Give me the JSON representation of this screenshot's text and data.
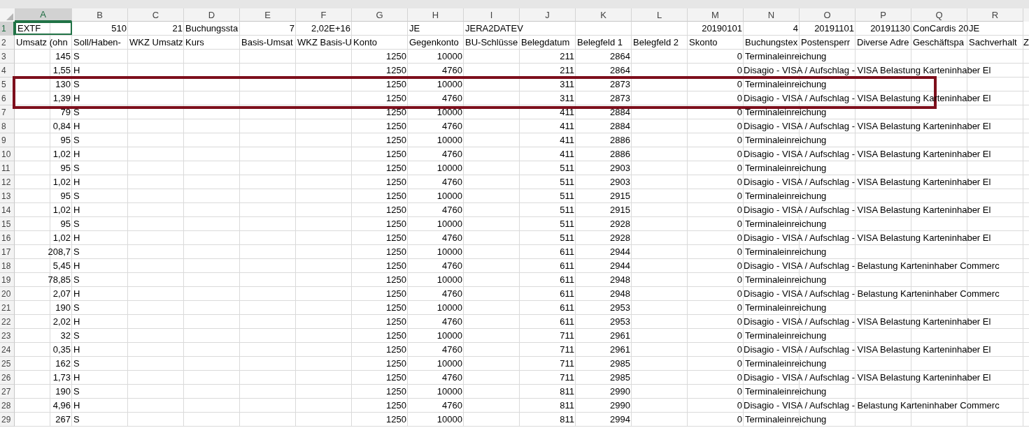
{
  "columns": [
    {
      "label": "A",
      "selected": true
    },
    {
      "label": "B",
      "selected": false
    },
    {
      "label": "C",
      "selected": false
    },
    {
      "label": "D",
      "selected": false
    },
    {
      "label": "E",
      "selected": false
    },
    {
      "label": "F",
      "selected": false
    },
    {
      "label": "G",
      "selected": false
    },
    {
      "label": "H",
      "selected": false
    },
    {
      "label": "I",
      "selected": false
    },
    {
      "label": "J",
      "selected": false
    },
    {
      "label": "K",
      "selected": false
    },
    {
      "label": "L",
      "selected": false
    },
    {
      "label": "M",
      "selected": false
    },
    {
      "label": "N",
      "selected": false
    },
    {
      "label": "O",
      "selected": false
    },
    {
      "label": "P",
      "selected": false
    },
    {
      "label": "Q",
      "selected": false
    },
    {
      "label": "R",
      "selected": false
    }
  ],
  "rows": [
    {
      "number": "1",
      "selected": true,
      "outlined": false,
      "cells": [
        {
          "text": "EXTF",
          "kind": "text"
        },
        {
          "text": "510",
          "kind": "number"
        },
        {
          "text": "21",
          "kind": "number"
        },
        {
          "text": "Buchungssta",
          "kind": "text"
        },
        {
          "text": "7",
          "kind": "number"
        },
        {
          "text": "2,02E+16",
          "kind": "number"
        },
        null,
        {
          "text": "JE",
          "kind": "text"
        },
        {
          "text": "JERA2DATEV",
          "kind": "text"
        },
        null,
        null,
        null,
        {
          "text": "20190101",
          "kind": "number"
        },
        {
          "text": "4",
          "kind": "number"
        },
        {
          "text": "20191101",
          "kind": "number"
        },
        {
          "text": "20191130",
          "kind": "number"
        },
        {
          "text": "ConCardis 20",
          "kind": "text"
        },
        {
          "text": "JE",
          "kind": "text"
        }
      ]
    },
    {
      "number": "2",
      "selected": false,
      "outlined": false,
      "cells": [
        {
          "text": "Umsatz (ohn",
          "kind": "text"
        },
        {
          "text": "Soll/Haben-",
          "kind": "text"
        },
        {
          "text": "WKZ Umsatz",
          "kind": "text"
        },
        {
          "text": "Kurs",
          "kind": "text"
        },
        {
          "text": "Basis-Umsat",
          "kind": "text"
        },
        {
          "text": "WKZ Basis-U",
          "kind": "text"
        },
        {
          "text": "Konto",
          "kind": "text"
        },
        {
          "text": "Gegenkonto",
          "kind": "text"
        },
        {
          "text": "BU-Schlüsse",
          "kind": "text"
        },
        {
          "text": "Belegdatum",
          "kind": "text"
        },
        {
          "text": "Belegfeld 1",
          "kind": "text"
        },
        {
          "text": "Belegfeld 2",
          "kind": "text"
        },
        {
          "text": "Skonto",
          "kind": "text"
        },
        {
          "text": "Buchungstex",
          "kind": "text"
        },
        {
          "text": "Postensperr",
          "kind": "text"
        },
        {
          "text": "Diverse Adre",
          "kind": "text"
        },
        {
          "text": "Geschäftspa",
          "kind": "text"
        },
        {
          "text": "Sachverhalt",
          "kind": "text"
        },
        {
          "text": "Z",
          "kind": "text"
        }
      ]
    },
    {
      "number": "3",
      "selected": false,
      "outlined": false,
      "cells": [
        {
          "text": "145",
          "kind": "number"
        },
        {
          "text": "S",
          "kind": "text"
        },
        null,
        null,
        null,
        null,
        {
          "text": "1250",
          "kind": "number"
        },
        {
          "text": "10000",
          "kind": "number"
        },
        null,
        {
          "text": "211",
          "kind": "number"
        },
        {
          "text": "2864",
          "kind": "number"
        },
        null,
        {
          "text": "0",
          "kind": "number"
        },
        {
          "text": "Terminaleinreichung",
          "kind": "text"
        }
      ]
    },
    {
      "number": "4",
      "selected": false,
      "outlined": false,
      "cells": [
        {
          "text": "1,55",
          "kind": "number"
        },
        {
          "text": "H",
          "kind": "text"
        },
        null,
        null,
        null,
        null,
        {
          "text": "1250",
          "kind": "number"
        },
        {
          "text": "4760",
          "kind": "number"
        },
        null,
        {
          "text": "211",
          "kind": "number"
        },
        {
          "text": "2864",
          "kind": "number"
        },
        null,
        {
          "text": "0",
          "kind": "number"
        },
        {
          "text": "Disagio - VISA / Aufschlag - VISA Belastung Karteninhaber El",
          "kind": "text"
        }
      ]
    },
    {
      "number": "5",
      "selected": false,
      "outlined": true,
      "cells": [
        {
          "text": "130",
          "kind": "number"
        },
        {
          "text": "S",
          "kind": "text"
        },
        null,
        null,
        null,
        null,
        {
          "text": "1250",
          "kind": "number"
        },
        {
          "text": "10000",
          "kind": "number"
        },
        null,
        {
          "text": "311",
          "kind": "number"
        },
        {
          "text": "2873",
          "kind": "number"
        },
        null,
        {
          "text": "0",
          "kind": "number"
        },
        {
          "text": "Terminaleinreichung",
          "kind": "text"
        }
      ]
    },
    {
      "number": "6",
      "selected": false,
      "outlined": true,
      "cells": [
        {
          "text": "1,39",
          "kind": "number"
        },
        {
          "text": "H",
          "kind": "text"
        },
        null,
        null,
        null,
        null,
        {
          "text": "1250",
          "kind": "number"
        },
        {
          "text": "4760",
          "kind": "number"
        },
        null,
        {
          "text": "311",
          "kind": "number"
        },
        {
          "text": "2873",
          "kind": "number"
        },
        null,
        {
          "text": "0",
          "kind": "number"
        },
        {
          "text": "Disagio - VISA / Aufschlag - VISA Belastung Karteninhaber El",
          "kind": "text"
        }
      ]
    },
    {
      "number": "7",
      "selected": false,
      "outlined": false,
      "cells": [
        {
          "text": "79",
          "kind": "number"
        },
        {
          "text": "S",
          "kind": "text"
        },
        null,
        null,
        null,
        null,
        {
          "text": "1250",
          "kind": "number"
        },
        {
          "text": "10000",
          "kind": "number"
        },
        null,
        {
          "text": "411",
          "kind": "number"
        },
        {
          "text": "2884",
          "kind": "number"
        },
        null,
        {
          "text": "0",
          "kind": "number"
        },
        {
          "text": "Terminaleinreichung",
          "kind": "text"
        }
      ]
    },
    {
      "number": "8",
      "selected": false,
      "outlined": false,
      "cells": [
        {
          "text": "0,84",
          "kind": "number"
        },
        {
          "text": "H",
          "kind": "text"
        },
        null,
        null,
        null,
        null,
        {
          "text": "1250",
          "kind": "number"
        },
        {
          "text": "4760",
          "kind": "number"
        },
        null,
        {
          "text": "411",
          "kind": "number"
        },
        {
          "text": "2884",
          "kind": "number"
        },
        null,
        {
          "text": "0",
          "kind": "number"
        },
        {
          "text": "Disagio - VISA / Aufschlag - VISA Belastung Karteninhaber El",
          "kind": "text"
        }
      ]
    },
    {
      "number": "9",
      "selected": false,
      "outlined": false,
      "cells": [
        {
          "text": "95",
          "kind": "number"
        },
        {
          "text": "S",
          "kind": "text"
        },
        null,
        null,
        null,
        null,
        {
          "text": "1250",
          "kind": "number"
        },
        {
          "text": "10000",
          "kind": "number"
        },
        null,
        {
          "text": "411",
          "kind": "number"
        },
        {
          "text": "2886",
          "kind": "number"
        },
        null,
        {
          "text": "0",
          "kind": "number"
        },
        {
          "text": "Terminaleinreichung",
          "kind": "text"
        }
      ]
    },
    {
      "number": "10",
      "selected": false,
      "outlined": false,
      "cells": [
        {
          "text": "1,02",
          "kind": "number"
        },
        {
          "text": "H",
          "kind": "text"
        },
        null,
        null,
        null,
        null,
        {
          "text": "1250",
          "kind": "number"
        },
        {
          "text": "4760",
          "kind": "number"
        },
        null,
        {
          "text": "411",
          "kind": "number"
        },
        {
          "text": "2886",
          "kind": "number"
        },
        null,
        {
          "text": "0",
          "kind": "number"
        },
        {
          "text": "Disagio - VISA / Aufschlag - VISA Belastung Karteninhaber El",
          "kind": "text"
        }
      ]
    },
    {
      "number": "11",
      "selected": false,
      "outlined": false,
      "cells": [
        {
          "text": "95",
          "kind": "number"
        },
        {
          "text": "S",
          "kind": "text"
        },
        null,
        null,
        null,
        null,
        {
          "text": "1250",
          "kind": "number"
        },
        {
          "text": "10000",
          "kind": "number"
        },
        null,
        {
          "text": "511",
          "kind": "number"
        },
        {
          "text": "2903",
          "kind": "number"
        },
        null,
        {
          "text": "0",
          "kind": "number"
        },
        {
          "text": "Terminaleinreichung",
          "kind": "text"
        }
      ]
    },
    {
      "number": "12",
      "selected": false,
      "outlined": false,
      "cells": [
        {
          "text": "1,02",
          "kind": "number"
        },
        {
          "text": "H",
          "kind": "text"
        },
        null,
        null,
        null,
        null,
        {
          "text": "1250",
          "kind": "number"
        },
        {
          "text": "4760",
          "kind": "number"
        },
        null,
        {
          "text": "511",
          "kind": "number"
        },
        {
          "text": "2903",
          "kind": "number"
        },
        null,
        {
          "text": "0",
          "kind": "number"
        },
        {
          "text": "Disagio - VISA / Aufschlag - VISA Belastung Karteninhaber El",
          "kind": "text"
        }
      ]
    },
    {
      "number": "13",
      "selected": false,
      "outlined": false,
      "cells": [
        {
          "text": "95",
          "kind": "number"
        },
        {
          "text": "S",
          "kind": "text"
        },
        null,
        null,
        null,
        null,
        {
          "text": "1250",
          "kind": "number"
        },
        {
          "text": "10000",
          "kind": "number"
        },
        null,
        {
          "text": "511",
          "kind": "number"
        },
        {
          "text": "2915",
          "kind": "number"
        },
        null,
        {
          "text": "0",
          "kind": "number"
        },
        {
          "text": "Terminaleinreichung",
          "kind": "text"
        }
      ]
    },
    {
      "number": "14",
      "selected": false,
      "outlined": false,
      "cells": [
        {
          "text": "1,02",
          "kind": "number"
        },
        {
          "text": "H",
          "kind": "text"
        },
        null,
        null,
        null,
        null,
        {
          "text": "1250",
          "kind": "number"
        },
        {
          "text": "4760",
          "kind": "number"
        },
        null,
        {
          "text": "511",
          "kind": "number"
        },
        {
          "text": "2915",
          "kind": "number"
        },
        null,
        {
          "text": "0",
          "kind": "number"
        },
        {
          "text": "Disagio - VISA / Aufschlag - VISA Belastung Karteninhaber El",
          "kind": "text"
        }
      ]
    },
    {
      "number": "15",
      "selected": false,
      "outlined": false,
      "cells": [
        {
          "text": "95",
          "kind": "number"
        },
        {
          "text": "S",
          "kind": "text"
        },
        null,
        null,
        null,
        null,
        {
          "text": "1250",
          "kind": "number"
        },
        {
          "text": "10000",
          "kind": "number"
        },
        null,
        {
          "text": "511",
          "kind": "number"
        },
        {
          "text": "2928",
          "kind": "number"
        },
        null,
        {
          "text": "0",
          "kind": "number"
        },
        {
          "text": "Terminaleinreichung",
          "kind": "text"
        }
      ]
    },
    {
      "number": "16",
      "selected": false,
      "outlined": false,
      "cells": [
        {
          "text": "1,02",
          "kind": "number"
        },
        {
          "text": "H",
          "kind": "text"
        },
        null,
        null,
        null,
        null,
        {
          "text": "1250",
          "kind": "number"
        },
        {
          "text": "4760",
          "kind": "number"
        },
        null,
        {
          "text": "511",
          "kind": "number"
        },
        {
          "text": "2928",
          "kind": "number"
        },
        null,
        {
          "text": "0",
          "kind": "number"
        },
        {
          "text": "Disagio - VISA / Aufschlag - VISA Belastung Karteninhaber El",
          "kind": "text"
        }
      ]
    },
    {
      "number": "17",
      "selected": false,
      "outlined": false,
      "cells": [
        {
          "text": "208,7",
          "kind": "number"
        },
        {
          "text": "S",
          "kind": "text"
        },
        null,
        null,
        null,
        null,
        {
          "text": "1250",
          "kind": "number"
        },
        {
          "text": "10000",
          "kind": "number"
        },
        null,
        {
          "text": "611",
          "kind": "number"
        },
        {
          "text": "2944",
          "kind": "number"
        },
        null,
        {
          "text": "0",
          "kind": "number"
        },
        {
          "text": "Terminaleinreichung",
          "kind": "text"
        }
      ]
    },
    {
      "number": "18",
      "selected": false,
      "outlined": false,
      "cells": [
        {
          "text": "5,45",
          "kind": "number"
        },
        {
          "text": "H",
          "kind": "text"
        },
        null,
        null,
        null,
        null,
        {
          "text": "1250",
          "kind": "number"
        },
        {
          "text": "4760",
          "kind": "number"
        },
        null,
        {
          "text": "611",
          "kind": "number"
        },
        {
          "text": "2944",
          "kind": "number"
        },
        null,
        {
          "text": "0",
          "kind": "number"
        },
        {
          "text": "Disagio - VISA / Aufschlag - Belastung Karteninhaber Commerc",
          "kind": "text"
        }
      ]
    },
    {
      "number": "19",
      "selected": false,
      "outlined": false,
      "cells": [
        {
          "text": "78,85",
          "kind": "number"
        },
        {
          "text": "S",
          "kind": "text"
        },
        null,
        null,
        null,
        null,
        {
          "text": "1250",
          "kind": "number"
        },
        {
          "text": "10000",
          "kind": "number"
        },
        null,
        {
          "text": "611",
          "kind": "number"
        },
        {
          "text": "2948",
          "kind": "number"
        },
        null,
        {
          "text": "0",
          "kind": "number"
        },
        {
          "text": "Terminaleinreichung",
          "kind": "text"
        }
      ]
    },
    {
      "number": "20",
      "selected": false,
      "outlined": false,
      "cells": [
        {
          "text": "2,07",
          "kind": "number"
        },
        {
          "text": "H",
          "kind": "text"
        },
        null,
        null,
        null,
        null,
        {
          "text": "1250",
          "kind": "number"
        },
        {
          "text": "4760",
          "kind": "number"
        },
        null,
        {
          "text": "611",
          "kind": "number"
        },
        {
          "text": "2948",
          "kind": "number"
        },
        null,
        {
          "text": "0",
          "kind": "number"
        },
        {
          "text": "Disagio - VISA / Aufschlag - Belastung Karteninhaber Commerc",
          "kind": "text"
        }
      ]
    },
    {
      "number": "21",
      "selected": false,
      "outlined": false,
      "cells": [
        {
          "text": "190",
          "kind": "number"
        },
        {
          "text": "S",
          "kind": "text"
        },
        null,
        null,
        null,
        null,
        {
          "text": "1250",
          "kind": "number"
        },
        {
          "text": "10000",
          "kind": "number"
        },
        null,
        {
          "text": "611",
          "kind": "number"
        },
        {
          "text": "2953",
          "kind": "number"
        },
        null,
        {
          "text": "0",
          "kind": "number"
        },
        {
          "text": "Terminaleinreichung",
          "kind": "text"
        }
      ]
    },
    {
      "number": "22",
      "selected": false,
      "outlined": false,
      "cells": [
        {
          "text": "2,02",
          "kind": "number"
        },
        {
          "text": "H",
          "kind": "text"
        },
        null,
        null,
        null,
        null,
        {
          "text": "1250",
          "kind": "number"
        },
        {
          "text": "4760",
          "kind": "number"
        },
        null,
        {
          "text": "611",
          "kind": "number"
        },
        {
          "text": "2953",
          "kind": "number"
        },
        null,
        {
          "text": "0",
          "kind": "number"
        },
        {
          "text": "Disagio - VISA / Aufschlag - VISA Belastung Karteninhaber El",
          "kind": "text"
        }
      ]
    },
    {
      "number": "23",
      "selected": false,
      "outlined": false,
      "cells": [
        {
          "text": "32",
          "kind": "number"
        },
        {
          "text": "S",
          "kind": "text"
        },
        null,
        null,
        null,
        null,
        {
          "text": "1250",
          "kind": "number"
        },
        {
          "text": "10000",
          "kind": "number"
        },
        null,
        {
          "text": "711",
          "kind": "number"
        },
        {
          "text": "2961",
          "kind": "number"
        },
        null,
        {
          "text": "0",
          "kind": "number"
        },
        {
          "text": "Terminaleinreichung",
          "kind": "text"
        }
      ]
    },
    {
      "number": "24",
      "selected": false,
      "outlined": false,
      "cells": [
        {
          "text": "0,35",
          "kind": "number"
        },
        {
          "text": "H",
          "kind": "text"
        },
        null,
        null,
        null,
        null,
        {
          "text": "1250",
          "kind": "number"
        },
        {
          "text": "4760",
          "kind": "number"
        },
        null,
        {
          "text": "711",
          "kind": "number"
        },
        {
          "text": "2961",
          "kind": "number"
        },
        null,
        {
          "text": "0",
          "kind": "number"
        },
        {
          "text": "Disagio - VISA / Aufschlag - VISA Belastung Karteninhaber El",
          "kind": "text"
        }
      ]
    },
    {
      "number": "25",
      "selected": false,
      "outlined": false,
      "cells": [
        {
          "text": "162",
          "kind": "number"
        },
        {
          "text": "S",
          "kind": "text"
        },
        null,
        null,
        null,
        null,
        {
          "text": "1250",
          "kind": "number"
        },
        {
          "text": "10000",
          "kind": "number"
        },
        null,
        {
          "text": "711",
          "kind": "number"
        },
        {
          "text": "2985",
          "kind": "number"
        },
        null,
        {
          "text": "0",
          "kind": "number"
        },
        {
          "text": "Terminaleinreichung",
          "kind": "text"
        }
      ]
    },
    {
      "number": "26",
      "selected": false,
      "outlined": false,
      "cells": [
        {
          "text": "1,73",
          "kind": "number"
        },
        {
          "text": "H",
          "kind": "text"
        },
        null,
        null,
        null,
        null,
        {
          "text": "1250",
          "kind": "number"
        },
        {
          "text": "4760",
          "kind": "number"
        },
        null,
        {
          "text": "711",
          "kind": "number"
        },
        {
          "text": "2985",
          "kind": "number"
        },
        null,
        {
          "text": "0",
          "kind": "number"
        },
        {
          "text": "Disagio - VISA / Aufschlag - VISA Belastung Karteninhaber El",
          "kind": "text"
        }
      ]
    },
    {
      "number": "27",
      "selected": false,
      "outlined": false,
      "cells": [
        {
          "text": "190",
          "kind": "number"
        },
        {
          "text": "S",
          "kind": "text"
        },
        null,
        null,
        null,
        null,
        {
          "text": "1250",
          "kind": "number"
        },
        {
          "text": "10000",
          "kind": "number"
        },
        null,
        {
          "text": "811",
          "kind": "number"
        },
        {
          "text": "2990",
          "kind": "number"
        },
        null,
        {
          "text": "0",
          "kind": "number"
        },
        {
          "text": "Terminaleinreichung",
          "kind": "text"
        }
      ]
    },
    {
      "number": "28",
      "selected": false,
      "outlined": false,
      "cells": [
        {
          "text": "4,96",
          "kind": "number"
        },
        {
          "text": "H",
          "kind": "text"
        },
        null,
        null,
        null,
        null,
        {
          "text": "1250",
          "kind": "number"
        },
        {
          "text": "4760",
          "kind": "number"
        },
        null,
        {
          "text": "811",
          "kind": "number"
        },
        {
          "text": "2990",
          "kind": "number"
        },
        null,
        {
          "text": "0",
          "kind": "number"
        },
        {
          "text": "Disagio - VISA / Aufschlag - Belastung Karteninhaber Commerc",
          "kind": "text"
        }
      ]
    },
    {
      "number": "29",
      "selected": false,
      "outlined": false,
      "cells": [
        {
          "text": "267",
          "kind": "number"
        },
        {
          "text": "S",
          "kind": "text"
        },
        null,
        null,
        null,
        null,
        {
          "text": "1250",
          "kind": "number"
        },
        {
          "text": "10000",
          "kind": "number"
        },
        null,
        {
          "text": "811",
          "kind": "number"
        },
        {
          "text": "2994",
          "kind": "number"
        },
        null,
        {
          "text": "0",
          "kind": "number"
        },
        {
          "text": "Terminaleinreichung",
          "kind": "text"
        }
      ]
    }
  ]
}
